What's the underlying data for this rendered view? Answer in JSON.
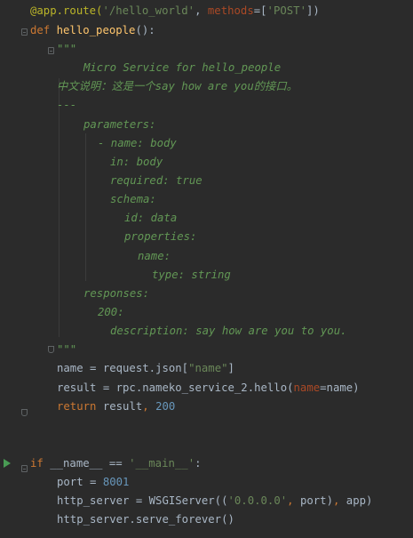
{
  "editor": {
    "lines": [
      {
        "tokens": [
          {
            "t": "@app.route(",
            "c": "dec"
          },
          {
            "t": "'/hello_world'",
            "c": "str"
          },
          {
            "t": ", ",
            "c": "plain"
          },
          {
            "t": "methods",
            "c": "prm"
          },
          {
            "t": "=[",
            "c": "plain"
          },
          {
            "t": "'POST'",
            "c": "str"
          },
          {
            "t": "])",
            "c": "plain"
          }
        ]
      },
      {
        "tokens": [
          {
            "t": "def ",
            "c": "kw"
          },
          {
            "t": "hello_people",
            "c": "fn"
          },
          {
            "t": "():",
            "c": "plain"
          }
        ]
      },
      {
        "tokens": [
          {
            "t": "\"\"\"",
            "c": "doc"
          }
        ]
      },
      {
        "tokens": [
          {
            "t": "Micro Service for hello_people",
            "c": "doc"
          }
        ]
      },
      {
        "tokens": [
          {
            "t": "中文说明：这是一个say how are you的接口。",
            "c": "doc"
          }
        ]
      },
      {
        "tokens": [
          {
            "t": "---",
            "c": "doc"
          }
        ]
      },
      {
        "tokens": [
          {
            "t": "parameters:",
            "c": "doc"
          }
        ]
      },
      {
        "tokens": [
          {
            "t": "- name: body",
            "c": "doc"
          }
        ]
      },
      {
        "tokens": [
          {
            "t": "in: body",
            "c": "doc"
          }
        ]
      },
      {
        "tokens": [
          {
            "t": "required: true",
            "c": "doc"
          }
        ]
      },
      {
        "tokens": [
          {
            "t": "schema:",
            "c": "doc"
          }
        ]
      },
      {
        "tokens": [
          {
            "t": "id: data",
            "c": "doc"
          }
        ]
      },
      {
        "tokens": [
          {
            "t": "properties:",
            "c": "doc"
          }
        ]
      },
      {
        "tokens": [
          {
            "t": "name:",
            "c": "doc"
          }
        ]
      },
      {
        "tokens": [
          {
            "t": "type: string",
            "c": "doc"
          }
        ]
      },
      {
        "tokens": [
          {
            "t": "responses:",
            "c": "doc"
          }
        ]
      },
      {
        "tokens": [
          {
            "t": "200:",
            "c": "doc"
          }
        ]
      },
      {
        "tokens": [
          {
            "t": "description: say how are you to you.",
            "c": "doc"
          }
        ]
      },
      {
        "tokens": [
          {
            "t": "\"\"\"",
            "c": "doc"
          }
        ]
      },
      {
        "tokens": [
          {
            "t": "name = request.json[",
            "c": "plain"
          },
          {
            "t": "\"name\"",
            "c": "str"
          },
          {
            "t": "]",
            "c": "plain"
          }
        ]
      },
      {
        "tokens": [
          {
            "t": "result = rpc.nameko_service_2.hello(",
            "c": "plain"
          },
          {
            "t": "name",
            "c": "prm"
          },
          {
            "t": "=name)",
            "c": "plain"
          }
        ]
      },
      {
        "tokens": [
          {
            "t": "return ",
            "c": "kw"
          },
          {
            "t": "result",
            "c": "plain"
          },
          {
            "t": ", ",
            "c": "kw"
          },
          {
            "t": "200",
            "c": "num"
          }
        ]
      },
      {
        "tokens": []
      },
      {
        "tokens": []
      },
      {
        "tokens": [
          {
            "t": "if ",
            "c": "kw"
          },
          {
            "t": "__name__ == ",
            "c": "plain"
          },
          {
            "t": "'__main__'",
            "c": "str"
          },
          {
            "t": ":",
            "c": "plain"
          }
        ]
      },
      {
        "tokens": [
          {
            "t": "port = ",
            "c": "plain"
          },
          {
            "t": "8001",
            "c": "num"
          }
        ]
      },
      {
        "tokens": [
          {
            "t": "http_server = WSGIServer((",
            "c": "plain"
          },
          {
            "t": "'0.0.0.0'",
            "c": "str"
          },
          {
            "t": ", ",
            "c": "kw"
          },
          {
            "t": "port)",
            "c": "plain"
          },
          {
            "t": ", ",
            "c": "kw"
          },
          {
            "t": "app)",
            "c": "plain"
          }
        ]
      },
      {
        "tokens": [
          {
            "t": "http_server.serve_forever()",
            "c": "plain"
          }
        ]
      }
    ],
    "colors": {
      "background": "#2b2b2b",
      "keyword": "#cc7832",
      "function": "#ffc66d",
      "string": "#6a8759",
      "docstring": "#629755",
      "number": "#6897bb",
      "decorator": "#bbb529",
      "parameter": "#aa4926",
      "text": "#a9b7c6"
    },
    "gutter_icons": [
      "fold-icon",
      "run-arrow-icon"
    ]
  }
}
